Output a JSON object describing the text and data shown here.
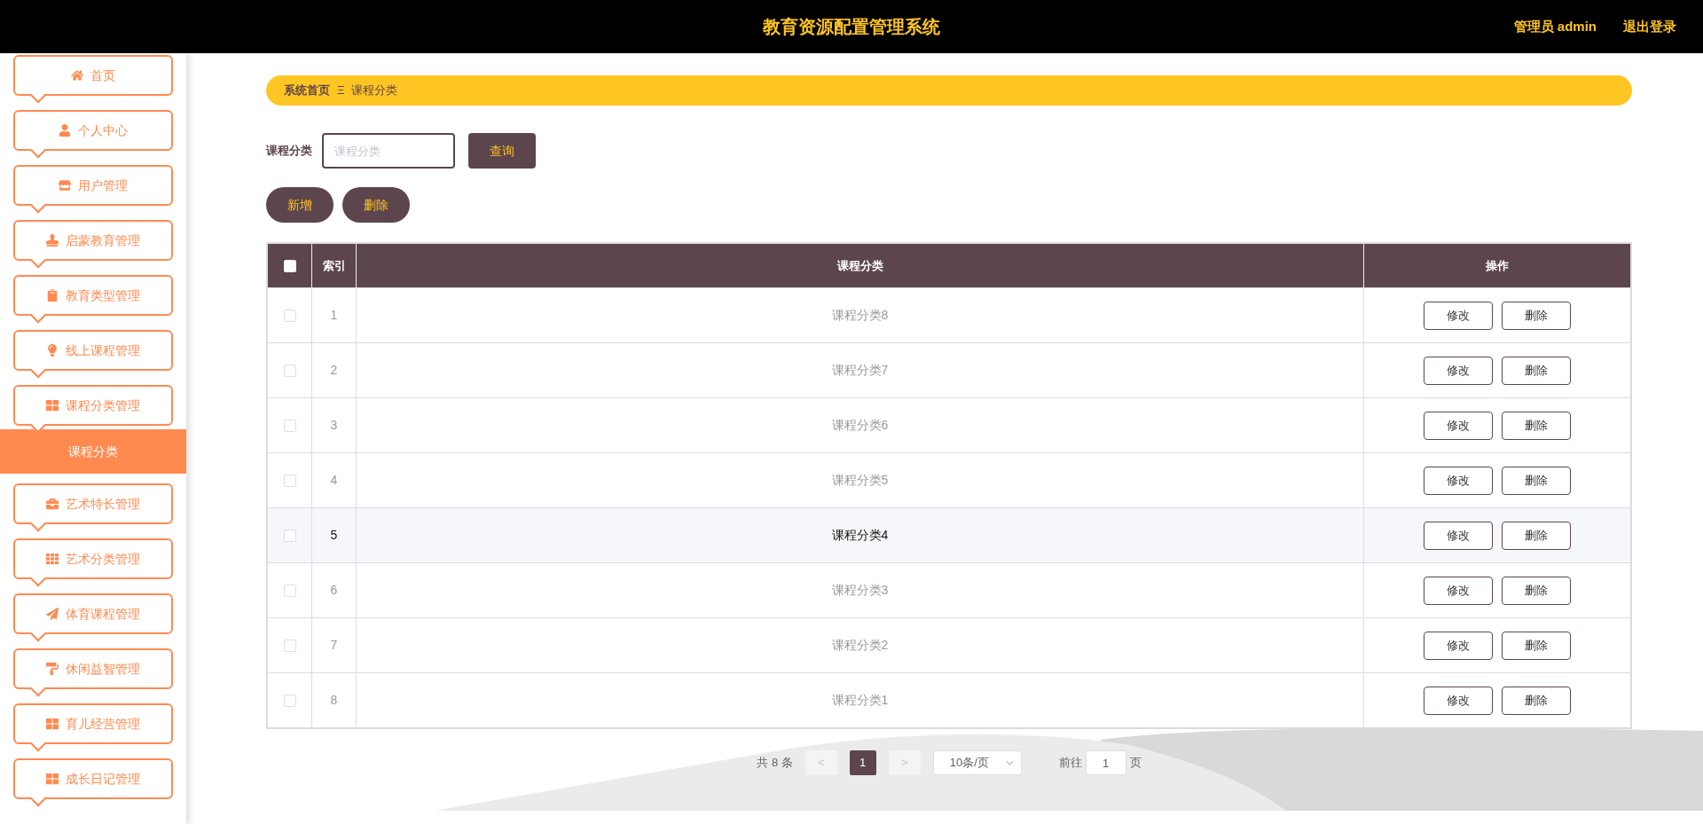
{
  "header": {
    "title": "教育资源配置管理系统",
    "user": "管理员 admin",
    "logout": "退出登录"
  },
  "sidebar": {
    "items": [
      {
        "label": "首页",
        "selected": false
      },
      {
        "label": "个人中心",
        "selected": false
      },
      {
        "label": "用户管理",
        "selected": false
      },
      {
        "label": "启蒙教育管理",
        "selected": false
      },
      {
        "label": "教育类型管理",
        "selected": false
      },
      {
        "label": "线上课程管理",
        "selected": false
      },
      {
        "label": "课程分类管理",
        "selected": false,
        "children": [
          {
            "label": "课程分类",
            "selected": true
          }
        ]
      },
      {
        "label": "艺术特长管理",
        "selected": false
      },
      {
        "label": "艺术分类管理",
        "selected": false
      },
      {
        "label": "体育课程管理",
        "selected": false
      },
      {
        "label": "休闲益智管理",
        "selected": false
      },
      {
        "label": "育儿经营管理",
        "selected": false
      },
      {
        "label": "成长日记管理",
        "selected": false
      }
    ]
  },
  "breadcrumb": [
    "系统首页",
    "课程分类"
  ],
  "breadcrumb_separator": "Ξ",
  "search": {
    "label": "课程分类",
    "placeholder": "课程分类",
    "button": "查询"
  },
  "actions": [
    "新增",
    "删除"
  ],
  "table": {
    "columns": [
      "索引",
      "课程分类",
      "操作"
    ],
    "all_checked": false,
    "rows": [
      {
        "index": "1",
        "name": "课程分类8",
        "checked": false,
        "highlighted": false,
        "actions": [
          "修改",
          "删除"
        ]
      },
      {
        "index": "2",
        "name": "课程分类7",
        "checked": false,
        "highlighted": false,
        "actions": [
          "修改",
          "删除"
        ]
      },
      {
        "index": "3",
        "name": "课程分类6",
        "checked": false,
        "highlighted": false,
        "actions": [
          "修改",
          "删除"
        ]
      },
      {
        "index": "4",
        "name": "课程分类5",
        "checked": false,
        "highlighted": false,
        "actions": [
          "修改",
          "删除"
        ]
      },
      {
        "index": "5",
        "name": "课程分类4",
        "checked": false,
        "highlighted": true,
        "actions": [
          "修改",
          "删除"
        ]
      },
      {
        "index": "6",
        "name": "课程分类3",
        "checked": false,
        "highlighted": false,
        "actions": [
          "修改",
          "删除"
        ]
      },
      {
        "index": "7",
        "name": "课程分类2",
        "checked": false,
        "highlighted": false,
        "actions": [
          "修改",
          "删除"
        ]
      },
      {
        "index": "8",
        "name": "课程分类1",
        "checked": false,
        "highlighted": false,
        "actions": [
          "修改",
          "删除"
        ]
      }
    ]
  },
  "pagination": {
    "total": "共 8 条",
    "prev": "<",
    "pages": [
      {
        "label": "1",
        "selected": true
      }
    ],
    "next": ">",
    "page_size": "10条/页",
    "goto_label": "前往",
    "goto_value": "1",
    "goto_suffix": "页"
  }
}
